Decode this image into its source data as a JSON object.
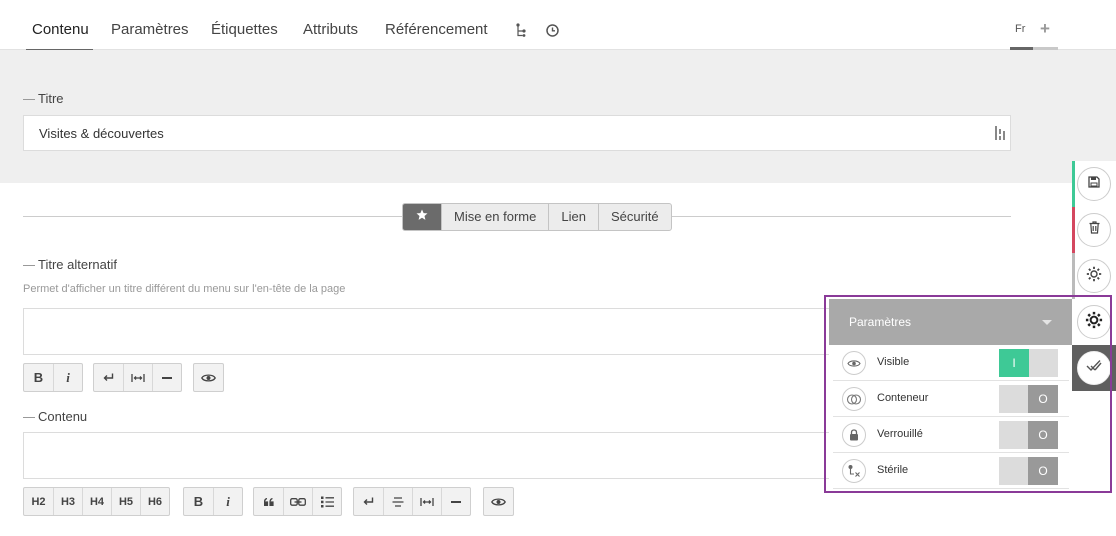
{
  "tabs": [
    {
      "label": "Contenu",
      "active": true
    },
    {
      "label": "Paramètres"
    },
    {
      "label": "Étiquettes"
    },
    {
      "label": "Attributs"
    },
    {
      "label": "Référencement"
    }
  ],
  "tab_icons": [
    "tree-icon",
    "clock-icon"
  ],
  "language": {
    "current": "Fr",
    "add": "+"
  },
  "title_field": {
    "label": "Titre",
    "value": "Visites & découvertes"
  },
  "segments": {
    "favorite_icon": "star-icon",
    "items": [
      "Mise en forme",
      "Lien",
      "Sécurité"
    ]
  },
  "alt_title": {
    "label": "Titre alternatif",
    "help": "Permet d'afficher un titre différent du menu sur l'en-tête de la page",
    "value": ""
  },
  "toolbar1": {
    "bold": "B",
    "italic": "i"
  },
  "content_field": {
    "label": "Contenu",
    "value": ""
  },
  "toolbar2": {
    "headings": [
      "H2",
      "H3",
      "H4",
      "H5",
      "H6"
    ],
    "bold": "B",
    "italic": "i"
  },
  "rail": {
    "buttons": [
      "save-icon",
      "trash-icon",
      "gear-icon",
      "gear-icon",
      "publish-check-icon"
    ],
    "accents": [
      "#3ec996",
      "#d4475f",
      "#bbbbbb"
    ]
  },
  "settings_panel": {
    "title": "Paramètres",
    "rows": [
      {
        "label": "Visible",
        "icon": "eye-icon",
        "state": "I",
        "on": true
      },
      {
        "label": "Conteneur",
        "icon": "container-icon",
        "state": "O",
        "on": false
      },
      {
        "label": "Verrouillé",
        "icon": "lock-icon",
        "state": "O",
        "on": false
      },
      {
        "label": "Stérile",
        "icon": "sterile-icon",
        "state": "O",
        "on": false
      }
    ]
  },
  "colors": {
    "accent_green": "#3ec996",
    "accent_red": "#d4475f",
    "highlight": "#8a3a98"
  }
}
